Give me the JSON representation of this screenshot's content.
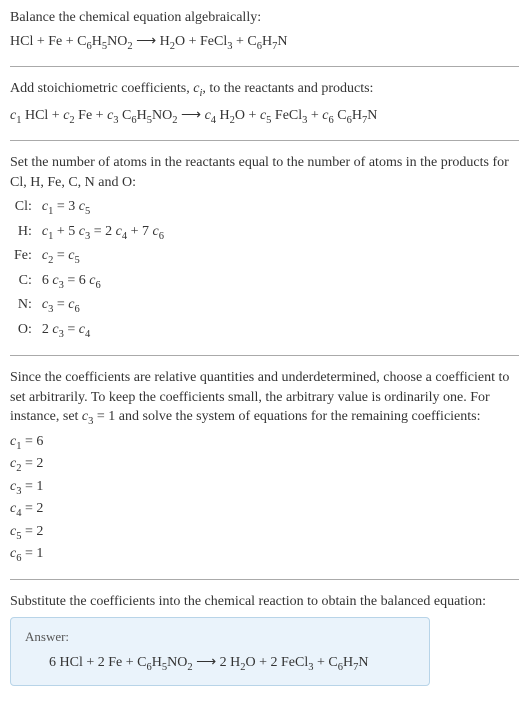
{
  "s1": {
    "intro": "Balance the chemical equation algebraically:",
    "eq_html": "HCl + Fe + C<sub>6</sub>H<sub>5</sub>NO<sub>2</sub>  ⟶  H<sub>2</sub>O + FeCl<sub>3</sub> + C<sub>6</sub>H<sub>7</sub>N"
  },
  "s2": {
    "intro_html": "Add stoichiometric coefficients, <span class=\"italic\">c<sub>i</sub></span>, to the reactants and products:",
    "eq_html": "<span class=\"italic\">c</span><sub>1</sub> HCl + <span class=\"italic\">c</span><sub>2</sub> Fe + <span class=\"italic\">c</span><sub>3</sub> C<sub>6</sub>H<sub>5</sub>NO<sub>2</sub>  ⟶  <span class=\"italic\">c</span><sub>4</sub> H<sub>2</sub>O + <span class=\"italic\">c</span><sub>5</sub> FeCl<sub>3</sub> + <span class=\"italic\">c</span><sub>6</sub> C<sub>6</sub>H<sub>7</sub>N"
  },
  "s3": {
    "intro": "Set the number of atoms in the reactants equal to the number of atoms in the products for Cl, H, Fe, C, N and O:",
    "rows": [
      {
        "el": "Cl:",
        "eq_html": "<span class=\"italic\">c</span><sub>1</sub> = 3 <span class=\"italic\">c</span><sub>5</sub>"
      },
      {
        "el": "H:",
        "eq_html": "<span class=\"italic\">c</span><sub>1</sub> + 5 <span class=\"italic\">c</span><sub>3</sub> = 2 <span class=\"italic\">c</span><sub>4</sub> + 7 <span class=\"italic\">c</span><sub>6</sub>"
      },
      {
        "el": "Fe:",
        "eq_html": "<span class=\"italic\">c</span><sub>2</sub> = <span class=\"italic\">c</span><sub>5</sub>"
      },
      {
        "el": "C:",
        "eq_html": "6 <span class=\"italic\">c</span><sub>3</sub> = 6 <span class=\"italic\">c</span><sub>6</sub>"
      },
      {
        "el": "N:",
        "eq_html": "<span class=\"italic\">c</span><sub>3</sub> = <span class=\"italic\">c</span><sub>6</sub>"
      },
      {
        "el": "O:",
        "eq_html": "2 <span class=\"italic\">c</span><sub>3</sub> = <span class=\"italic\">c</span><sub>4</sub>"
      }
    ]
  },
  "s4": {
    "intro_html": "Since the coefficients are relative quantities and underdetermined, choose a coefficient to set arbitrarily. To keep the coefficients small, the arbitrary value is ordinarily one. For instance, set <span class=\"italic\">c</span><sub>3</sub> = 1 and solve the system of equations for the remaining coefficients:",
    "coefs": [
      "<span class=\"italic\">c</span><sub>1</sub> = 6",
      "<span class=\"italic\">c</span><sub>2</sub> = 2",
      "<span class=\"italic\">c</span><sub>3</sub> = 1",
      "<span class=\"italic\">c</span><sub>4</sub> = 2",
      "<span class=\"italic\">c</span><sub>5</sub> = 2",
      "<span class=\"italic\">c</span><sub>6</sub> = 1"
    ]
  },
  "s5": {
    "intro": "Substitute the coefficients into the chemical reaction to obtain the balanced equation:",
    "answer_label": "Answer:",
    "answer_eq_html": "6 HCl + 2 Fe + C<sub>6</sub>H<sub>5</sub>NO<sub>2</sub>  ⟶  2 H<sub>2</sub>O + 2 FeCl<sub>3</sub> + C<sub>6</sub>H<sub>7</sub>N"
  },
  "chart_data": {
    "type": "table",
    "title": "Balanced chemical equation coefficients",
    "unbalanced_equation": "HCl + Fe + C6H5NO2 → H2O + FeCl3 + C6H7N",
    "atom_balance": [
      {
        "element": "Cl",
        "equation": "c1 = 3 c5"
      },
      {
        "element": "H",
        "equation": "c1 + 5 c3 = 2 c4 + 7 c6"
      },
      {
        "element": "Fe",
        "equation": "c2 = c5"
      },
      {
        "element": "C",
        "equation": "6 c3 = 6 c6"
      },
      {
        "element": "N",
        "equation": "c3 = c6"
      },
      {
        "element": "O",
        "equation": "2 c3 = c4"
      }
    ],
    "coefficients": {
      "c1": 6,
      "c2": 2,
      "c3": 1,
      "c4": 2,
      "c5": 2,
      "c6": 1
    },
    "balanced_equation": "6 HCl + 2 Fe + C6H5NO2 → 2 H2O + 2 FeCl3 + C6H7N"
  }
}
